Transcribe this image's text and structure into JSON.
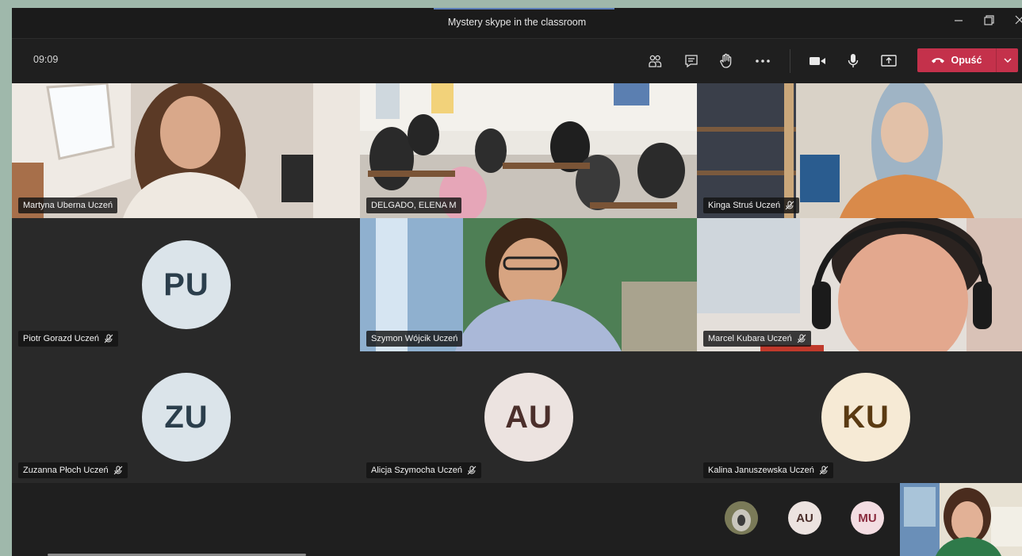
{
  "window": {
    "title": "Mystery skype in the classroom",
    "controls": [
      "minimize",
      "maximize",
      "close"
    ]
  },
  "toolbar": {
    "time": "09:09",
    "buttons": [
      "participants-icon",
      "chat-icon",
      "raise-hand-icon",
      "more-icon",
      "camera-icon",
      "microphone-icon",
      "share-icon"
    ],
    "leave_label": "Opuść",
    "leave_color": "#c4314b"
  },
  "tiles": [
    {
      "name": "Martyna Uberna Uczeń",
      "type": "video",
      "muted": false
    },
    {
      "name": "DELGADO, ELENA M",
      "type": "video",
      "muted": false
    },
    {
      "name": "Kinga Struś Uczeń",
      "type": "video",
      "muted": true
    },
    {
      "name": "Piotr Gorazd Uczeń",
      "type": "avatar",
      "initials": "PU",
      "avatar_bg": "#dbe4ea",
      "avatar_fg": "#2b3e4c",
      "muted": true
    },
    {
      "name": "Szymon Wójcik Uczeń",
      "type": "video",
      "muted": false
    },
    {
      "name": "Marcel Kubara Uczeń",
      "type": "video",
      "muted": true
    },
    {
      "name": "Zuzanna Płoch Uczeń",
      "type": "avatar",
      "initials": "ZU",
      "avatar_bg": "#dbe4ea",
      "avatar_fg": "#2b3e4c",
      "muted": true
    },
    {
      "name": "Alicja Szymocha Uczeń",
      "type": "avatar",
      "initials": "AU",
      "avatar_bg": "#ece3e0",
      "avatar_fg": "#4b2f2b",
      "muted": true
    },
    {
      "name": "Kalina Januszewska Uczeń",
      "type": "avatar",
      "initials": "KU",
      "avatar_bg": "#f6ead5",
      "avatar_fg": "#5a3a12",
      "muted": true
    }
  ],
  "overflow_participants": [
    {
      "initials": "",
      "type": "photo"
    },
    {
      "initials": "AU",
      "bg": "#ece3e0",
      "fg": "#4b2f2b"
    },
    {
      "initials": "MU",
      "bg": "#f3dde2",
      "fg": "#8a2b3e"
    }
  ]
}
